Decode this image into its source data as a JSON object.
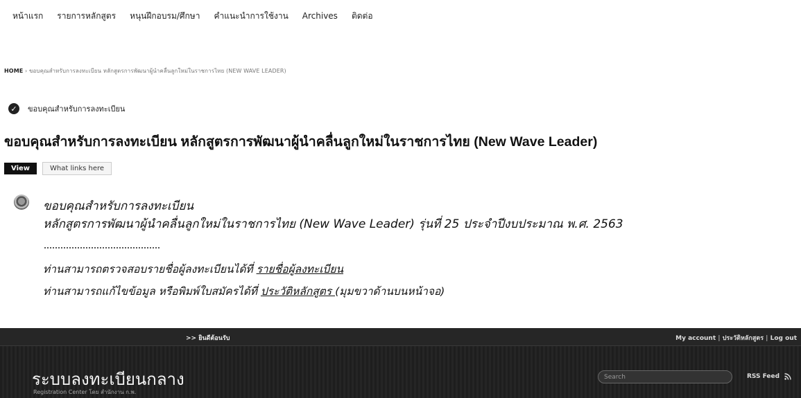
{
  "nav": {
    "items": [
      {
        "label": "หน้าแรก"
      },
      {
        "label": "รายการหลักสูตร"
      },
      {
        "label": "หนุนฝึกอบรม/ศึกษา"
      },
      {
        "label": "คำแนะนำการใช้งาน"
      },
      {
        "label": "Archives"
      },
      {
        "label": "ติดต่อ"
      }
    ]
  },
  "breadcrumb": {
    "home": "HOME",
    "separator": "›",
    "current": "ขอบคุณสำหรับการลงทะเบียน หลักสูตรการพัฒนาผู้นำคลื่นลูกใหม่ในราชการไทย (NEW WAVE LEADER)"
  },
  "status": {
    "message": "ขอบคุณสำหรับการลงทะเบียน"
  },
  "page": {
    "title": "ขอบคุณสำหรับการลงทะเบียน หลักสูตรการพัฒนาผู้นำคลื่นลูกใหม่ในราชการไทย (New Wave Leader)"
  },
  "tabs": {
    "view": "View",
    "what_links_here": "What links here"
  },
  "content": {
    "line1": "ขอบคุณสำหรับการลงทะเบียน",
    "line2": "หลักสูตรการพัฒนาผู้นำคลื่นลูกใหม่ในราชการไทย (New Wave Leader) รุ่นที่ 25 ประจำปีงบประมาณ พ.ศ. 2563",
    "line3_prefix": "ท่านสามารถตรวจสอบรายชื่อผู้ลงทะเบียนได้ที่ ",
    "line3_link": "รายชื่อผู้ลงทะเบียน",
    "line4_prefix": "ท่านสามารถแก้ไขข้อมูล หรือพิมพ์ใบสมัครได้ที่ ",
    "line4_link": "ประวัติหลักสูตร ",
    "line4_suffix": "(มุมขวาด้านบนหน้าจอ)"
  },
  "footer_header": {
    "welcome": ">> ยินดีต้อนรับ",
    "account": "My account",
    "history": "ประวัติหลักสูตร",
    "logout": "Log out",
    "separator": " | ",
    "site_name": "ระบบลงทะเบียนกลาง",
    "site_slogan": "Registration Center โดย สำนักงาน ก.พ.",
    "search_placeholder": "Search",
    "rss": "RSS Feed"
  },
  "colors": {
    "footer_bg": "#222222",
    "active_tab_bg": "#111111"
  },
  "icons": {
    "status": "check-circle-icon",
    "content": "seal-icon",
    "rss": "rss-icon"
  }
}
